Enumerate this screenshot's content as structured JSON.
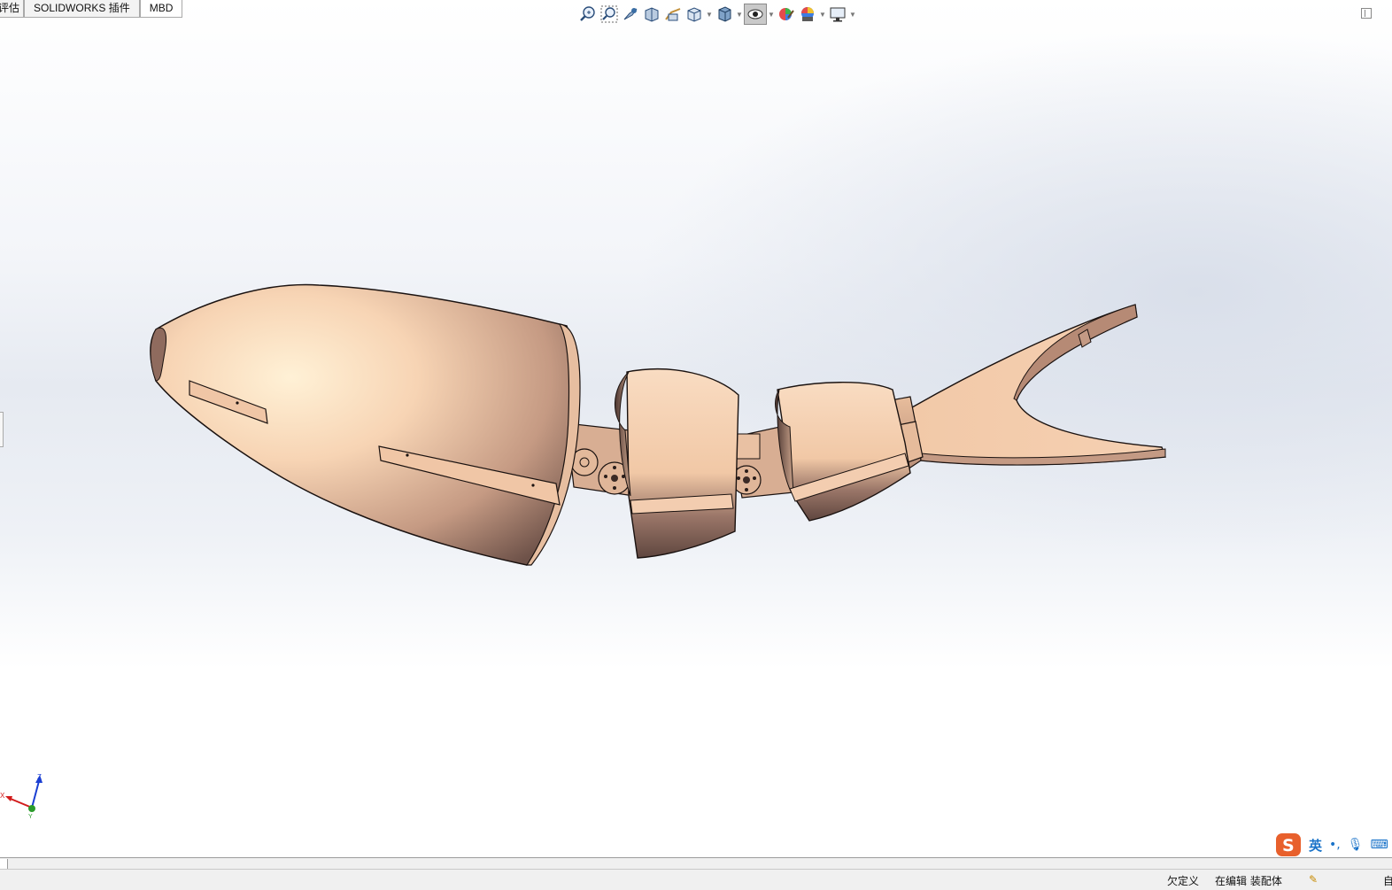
{
  "tabs": [
    {
      "label": "评估",
      "active": false
    },
    {
      "label": "SOLIDWORKS 插件",
      "active": false
    },
    {
      "label": "MBD",
      "active": true
    }
  ],
  "hud_tools": [
    {
      "icon": "zoom-to-fit-icon"
    },
    {
      "icon": "zoom-to-area-icon"
    },
    {
      "icon": "previous-view-icon"
    },
    {
      "icon": "section-view-icon"
    },
    {
      "icon": "dynamic-annotation-views-icon"
    },
    {
      "icon": "view-orientation-icon"
    },
    {
      "icon": "display-style-icon"
    },
    {
      "icon": "hide-show-items-icon"
    },
    {
      "icon": "edit-appearance-icon"
    },
    {
      "icon": "apply-scene-icon"
    },
    {
      "icon": "view-settings-icon"
    }
  ],
  "triad": {
    "x_label": "X",
    "y_label": "Y",
    "z_label": "Z"
  },
  "ime": {
    "language": "英"
  },
  "status": {
    "definition": "欠定义",
    "mode": "在编辑 装配体",
    "units": "自"
  },
  "colors": {
    "model_body": "#f2c9a8",
    "model_shadow": "#7a5a50",
    "model_edge": "#1a1210",
    "ime_accent": "#e8602c",
    "ime_text": "#1a73c9",
    "triad_x": "#d21b1b",
    "triad_y": "#2b9b2b",
    "triad_z": "#1b3fd2"
  }
}
